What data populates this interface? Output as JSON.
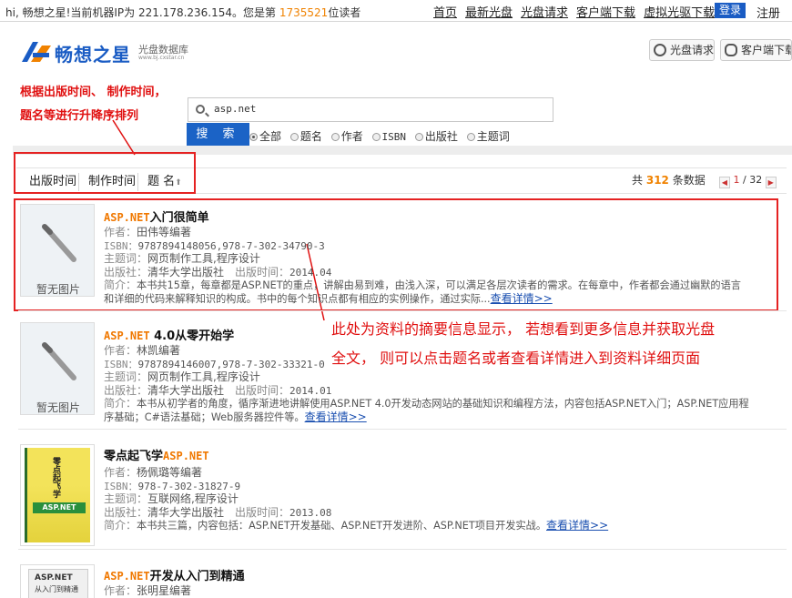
{
  "topbar": {
    "welcome_prefix": "hi, 畅想之星!当前机器IP为 221.178.236.154。您是第",
    "visitor_number": "1735521",
    "welcome_suffix": "位读者",
    "nav": [
      "首页",
      "最新光盘",
      "光盘请求",
      "客户端下载",
      "虚拟光驱下载"
    ],
    "login": "登录",
    "register": "注册"
  },
  "header": {
    "brand": "畅想之星",
    "brand_sub": "光盘数据库",
    "brand_url": "www.bj.cxstar.cn",
    "btn_request": "光盘请求",
    "btn_client": "客户端下载"
  },
  "annotations": {
    "sort_note_line1": "根据出版时间、  制作时间，",
    "sort_note_line2": "题名等进行升降序排列",
    "summary_note_line1": "此处为资料的摘要信息显示，  若想看到更多信息并获取光盘",
    "summary_note_line2": "全文，  则可以点击题名或者查看详情进入到资料详细页面"
  },
  "search": {
    "value": "asp.net",
    "button": "搜 索",
    "options": [
      "全部",
      "题名",
      "作者",
      "ISBN",
      "出版社",
      "主题词"
    ],
    "selected": "全部"
  },
  "sort": {
    "by_pub_date": "出版时间",
    "by_make_date": "制作时间",
    "by_title": "题  名",
    "title_arrow": "⬆"
  },
  "results": {
    "count_prefix": "共",
    "count": "312",
    "count_suffix": "条数据",
    "page_current": "1",
    "page_total": "/ 32",
    "prev": "◀",
    "next": "▶"
  },
  "labels": {
    "author": "作者：",
    "isbn": "ISBN：",
    "subject": "主题词：",
    "publisher": "出版社：",
    "pub_date": "出版时间：",
    "summary": "简介：",
    "more": "查看详情>>",
    "no_image": "暂无图片"
  },
  "records": [
    {
      "title_hl": "ASP.NET",
      "title_rest": "入门很简单",
      "author": "田伟等编著",
      "isbn": "9787894148056,978-7-302-34790-3",
      "subject": "网页制作工具,程序设计",
      "publisher": "清华大学出版社",
      "pub_date": "2014.04",
      "summary_line1": "本书共15章，每章都是ASP.NET的重点，讲解由易到难，由浅入深，可以满足各层次读者的需求。在每章中，作者都会通过幽默的语言",
      "summary_line2": "和详细的代码来解释知识的构成。书中的每个知识点都有相应的实例操作，通过实际...",
      "has_image": false
    },
    {
      "title_hl": "ASP.NET",
      "title_rest": " 4.0从零开始学",
      "author": "林凯编著",
      "isbn": "9787894146007,978-7-302-33321-0",
      "subject": "网页制作工具,程序设计",
      "publisher": "清华大学出版社",
      "pub_date": "2014.01",
      "summary_line1": "本书从初学者的角度，循序渐进地讲解使用ASP.NET 4.0开发动态网站的基础知识和编程方法，内容包括ASP.NET入门；ASP.NET应用程",
      "summary_line2": "序基础；C#语法基础；Web服务器控件等。",
      "has_image": false
    },
    {
      "title_pre": "零点起飞学",
      "title_hl": "ASP.NET",
      "author": "杨佩璐等编著",
      "isbn": "978-7-302-31827-9",
      "subject": "互联网络,程序设计",
      "publisher": "清华大学出版社",
      "pub_date": "2013.08",
      "summary_line1": "本书共三篇，内容包括：ASP.NET开发基础、ASP.NET开发进阶、ASP.NET项目开发实战。",
      "cover_text_cn": "零点起飞学",
      "cover_text_en": "ASP.NET",
      "has_image": true
    },
    {
      "title_hl": "ASP.NET",
      "title_rest": "开发从入门到精通",
      "author": "张明星编著",
      "cover_text_en": "ASP.NET",
      "cover_text_cn": "从入门到精通",
      "has_image": true
    }
  ],
  "colors": {
    "brand_blue": "#1a5cc4",
    "highlight_orange": "#f07800",
    "annotation_red": "#e01010"
  }
}
